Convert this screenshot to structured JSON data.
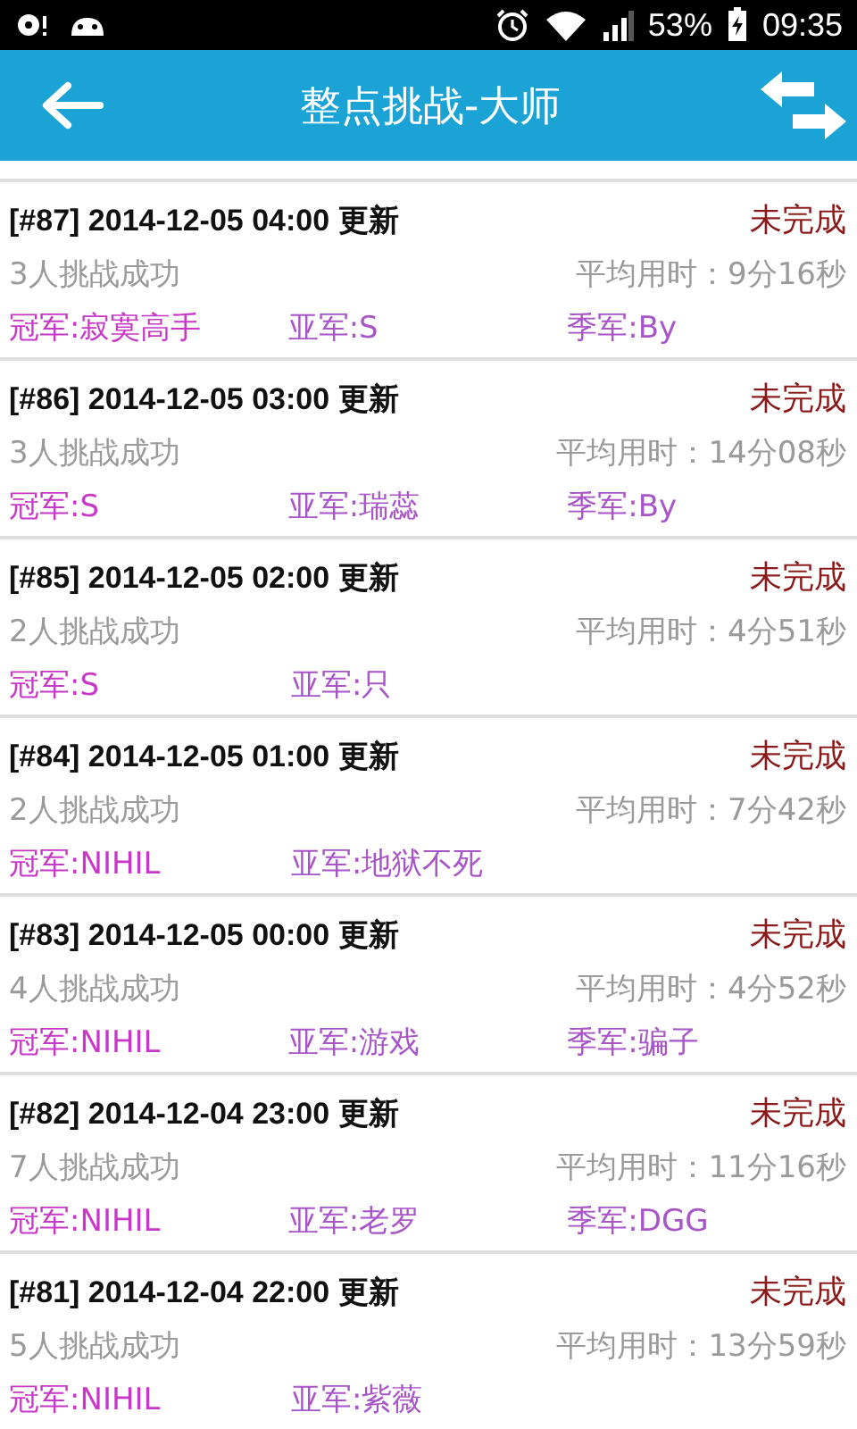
{
  "status_bar": {
    "battery": "53%",
    "time": "09:35"
  },
  "header": {
    "title": "整点挑战-大师"
  },
  "records": [
    {
      "title": "[#87] 2014-12-05 04:00 更新",
      "status": "未完成",
      "success": "3人挑战成功",
      "avg_time": "平均用时：9分16秒",
      "champion": "冠军:寂寞高手",
      "runner_up": "亚军:S",
      "third": "季军:By"
    },
    {
      "title": "[#86] 2014-12-05 03:00 更新",
      "status": "未完成",
      "success": "3人挑战成功",
      "avg_time": "平均用时：14分08秒",
      "champion": "冠军:S",
      "runner_up": "亚军:瑞蕊",
      "third": "季军:By"
    },
    {
      "title": "[#85] 2014-12-05 02:00 更新",
      "status": "未完成",
      "success": "2人挑战成功",
      "avg_time": "平均用时：4分51秒",
      "champion": "冠军:S",
      "runner_up": "亚军:只"
    },
    {
      "title": "[#84] 2014-12-05 01:00 更新",
      "status": "未完成",
      "success": "2人挑战成功",
      "avg_time": "平均用时：7分42秒",
      "champion": "冠军:NIHIL",
      "runner_up": "亚军:地狱不死"
    },
    {
      "title": "[#83] 2014-12-05 00:00 更新",
      "status": "未完成",
      "success": "4人挑战成功",
      "avg_time": "平均用时：4分52秒",
      "champion": "冠军:NIHIL",
      "runner_up": "亚军:游戏",
      "third": "季军:骗子"
    },
    {
      "title": "[#82] 2014-12-04 23:00 更新",
      "status": "未完成",
      "success": "7人挑战成功",
      "avg_time": "平均用时：11分16秒",
      "champion": "冠军:NIHIL",
      "runner_up": "亚军:老罗",
      "third": "季军:DGG"
    },
    {
      "title": "[#81] 2014-12-04 22:00 更新",
      "status": "未完成",
      "success": "5人挑战成功",
      "avg_time": "平均用时：13分59秒",
      "champion": "冠军:NIHIL",
      "runner_up": "亚军:紫薇"
    }
  ]
}
